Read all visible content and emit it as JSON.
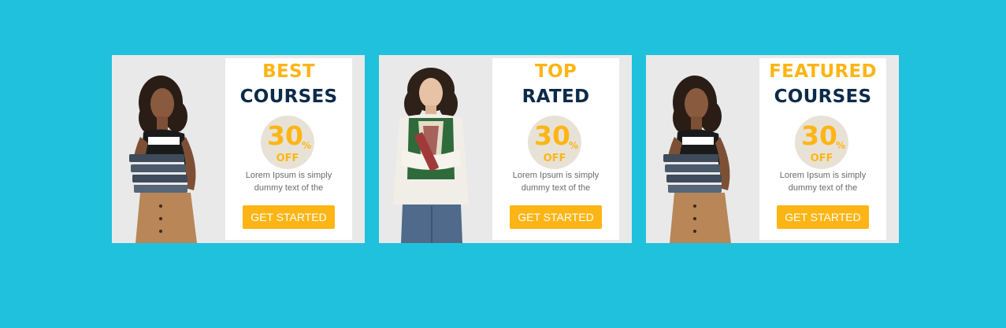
{
  "cards": [
    {
      "title_top": "BEST",
      "title_bottom": "COURSES",
      "discount_number": "30",
      "discount_percent": "%",
      "discount_off": "OFF",
      "description": "Lorem Ipsum is simply dummy text of the",
      "button_label": "GET STARTED",
      "photo": "woman-holding-books"
    },
    {
      "title_top": "TOP",
      "title_bottom": "RATED",
      "discount_number": "30",
      "discount_percent": "%",
      "discount_off": "OFF",
      "description": "Lorem Ipsum is simply dummy text of the",
      "button_label": "GET STARTED",
      "photo": "woman-in-sweater-vest"
    },
    {
      "title_top": "FEATURED",
      "title_bottom": "COURSES",
      "discount_number": "30",
      "discount_percent": "%",
      "discount_off": "OFF",
      "description": "Lorem Ipsum is simply dummy text of the",
      "button_label": "GET STARTED",
      "photo": "woman-holding-books"
    }
  ],
  "colors": {
    "background": "#20c1dc",
    "accent": "#fdb515",
    "heading": "#0c2a49",
    "badge": "#e8e2d6",
    "card": "#e9e9e9",
    "body_text": "#6b6b6b"
  }
}
